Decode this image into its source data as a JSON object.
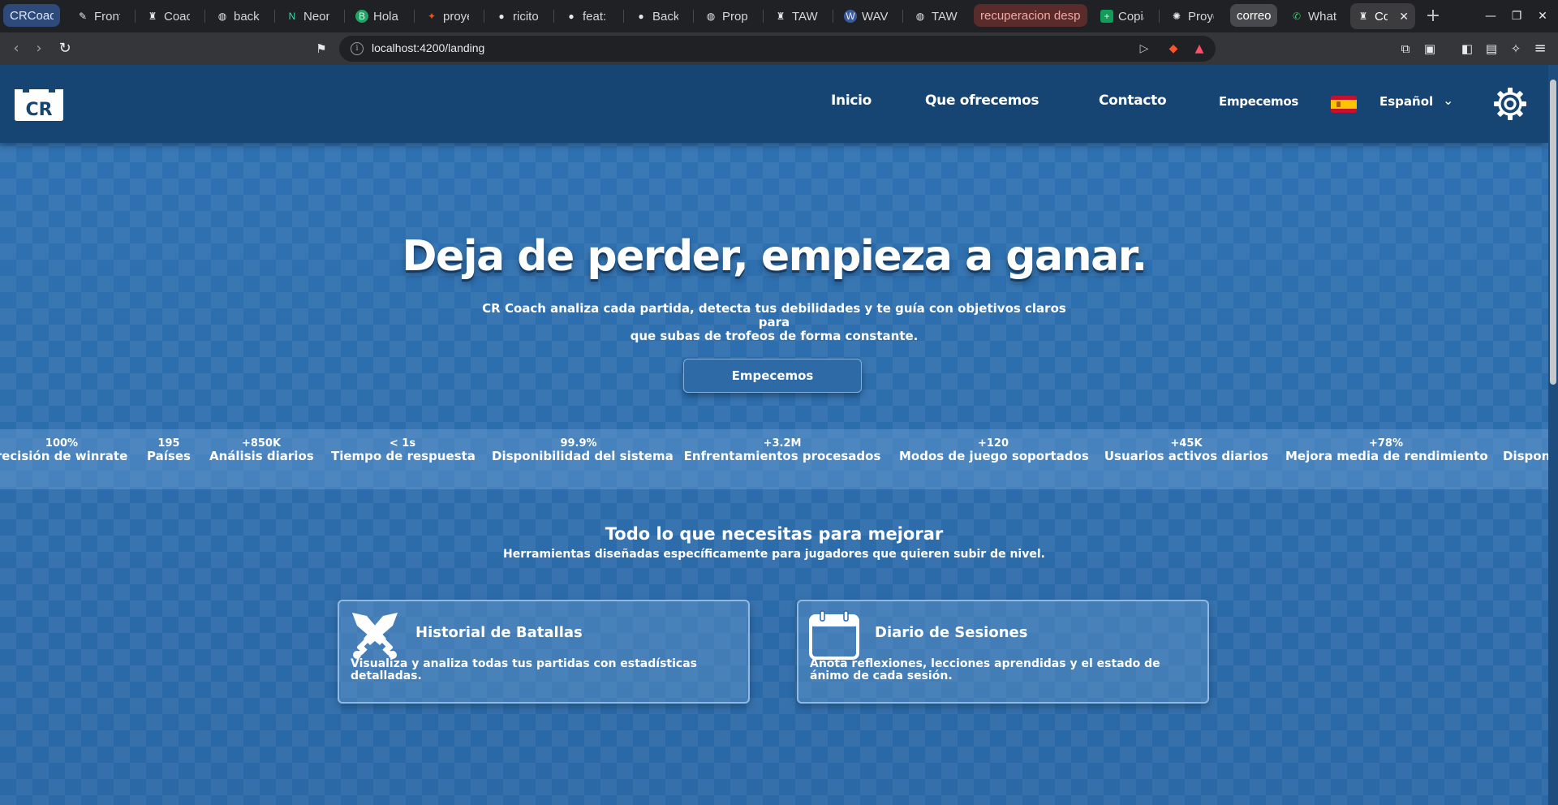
{
  "browser": {
    "tabs": [
      {
        "title": "CRCoach",
        "icon": "tab-group-label"
      },
      {
        "title": "Front",
        "icon": "fork-icon"
      },
      {
        "title": "Coach",
        "icon": "castle-icon"
      },
      {
        "title": "backe",
        "icon": "globe-icon"
      },
      {
        "title": "Neon",
        "icon": "neon-icon"
      },
      {
        "title": "Hola,",
        "icon": "b-icon"
      },
      {
        "title": "proye",
        "icon": "figma-icon"
      },
      {
        "title": "ricito",
        "icon": "github-icon"
      },
      {
        "title": "feat:",
        "icon": "github-icon"
      },
      {
        "title": "Backl",
        "icon": "github-icon"
      },
      {
        "title": "Propu",
        "icon": "globe-icon"
      },
      {
        "title": "TAW",
        "icon": "castle-icon"
      },
      {
        "title": "WAVE",
        "icon": "w-icon"
      },
      {
        "title": "TAW",
        "icon": "globe-icon"
      },
      {
        "title": "recuperacion desplie",
        "icon": "tab-group-label"
      },
      {
        "title": "Copia",
        "icon": "sheets-icon"
      },
      {
        "title": "Proye",
        "icon": "openai-icon"
      },
      {
        "title": "correo",
        "icon": "tab-group-label"
      },
      {
        "title": "What",
        "icon": "whatsapp-icon"
      },
      {
        "title": "Co",
        "icon": "castle-icon"
      }
    ],
    "url": "localhost:4200/landing"
  },
  "navbar": {
    "logo_text": "CR",
    "links": [
      "Inicio",
      "Que ofrecemos",
      "Contacto",
      "Empecemos"
    ],
    "language": "Español"
  },
  "hero": {
    "title": "Deja de perder, empieza a ganar.",
    "subtitle_line1": "CR Coach analiza cada partida, detecta tus debilidades y te guía con objetivos claros para",
    "subtitle_line2": "que subas de trofeos de forma constante.",
    "cta": "Empecemos"
  },
  "stats": [
    {
      "value": "100%",
      "label": "recisión de winrate"
    },
    {
      "value": "195",
      "label": "Países"
    },
    {
      "value": "+850K",
      "label": "Análisis diarios"
    },
    {
      "value": "< 1s",
      "label": "Tiempo de respuesta"
    },
    {
      "value": "99.9%",
      "label": "Disponibilidad del sistema"
    },
    {
      "value": "+3.2M",
      "label": "Enfrentamientos procesados"
    },
    {
      "value": "+120",
      "label": "Modos de juego soportados"
    },
    {
      "value": "+45K",
      "label": "Usuarios activos diarios"
    },
    {
      "value": "+78%",
      "label": "Mejora media de rendimiento"
    },
    {
      "value": "",
      "label": "Dispon"
    }
  ],
  "features": {
    "title": "Todo lo que necesitas para mejorar",
    "subtitle": "Herramientas diseñadas específicamente para jugadores que quieren subir de nivel.",
    "cards": [
      {
        "title": "Historial de Batallas",
        "text": "Visualiza y analiza todas tus partidas con estadísticas detalladas.",
        "icon": "crossed-swords-icon"
      },
      {
        "title": "Diario de Sesiones",
        "text": "Anota reflexiones, lecciones aprendidas y el estado de ánimo de cada sesión.",
        "icon": "calendar-icon"
      }
    ]
  },
  "colors": {
    "navbar": "#164573",
    "page_bg": "#2a6aa8",
    "accent": "#8fb9e4"
  }
}
